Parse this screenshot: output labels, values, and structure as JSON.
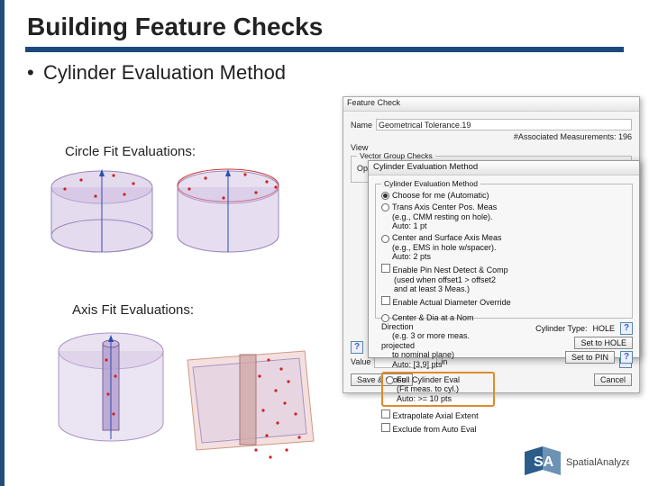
{
  "title": "Building Feature Checks",
  "bullet": "Cylinder Evaluation Method",
  "sections": {
    "circle": "Circle Fit Evaluations:",
    "axis": "Axis Fit Evaluations:"
  },
  "back_dialog": {
    "title": "Feature Check",
    "name_label": "Name",
    "name_value": "Geometrical Tolerance.19",
    "assoc": "#Associated Measurements: 196",
    "view_label": "View",
    "group_vector": "Vector Group Checks",
    "options_label": "Options",
    "value_label": "Value",
    "value_unit": "in",
    "save_close": "Save & Close",
    "cancel": "Cancel"
  },
  "front_dialog": {
    "title": "Cylinder Evaluation Method",
    "group": "Cylinder Evaluation Method",
    "opt1": "Choose for me (Automatic)",
    "opt2a": "Trans Axis Center Pos. Meas",
    "opt2b": "(e.g., CMM resting on hole).",
    "opt2c": "Auto: 1 pt",
    "opt3a": "Center and Surface Axis Meas",
    "opt3b": "(e.g., EMS in hole w/spacer).",
    "opt3c": "Auto: 2 pts",
    "opt4a": "Center & Dia at a Nom Direction",
    "opt4b": "(e.g. 3 or more meas. projected",
    "opt4c": "to nominal plane)",
    "opt4d": "Auto: [3,9] pts",
    "opt5a": "Full Cylinder Eval",
    "opt5b": "(Fit meas. to cyl.)",
    "opt5c": "Auto: >= 10 pts",
    "chk_extrap": "Extrapolate Axial Extent",
    "chk_excl": "Exclude from Auto Eval",
    "nest_a": "Enable Pin Nest Detect & Comp",
    "nest_b": "(used when offset1 > offset2",
    "nest_c": "and at least 3 Meas.)",
    "override": "Enable Actual Diameter Override",
    "ctype_label": "Cylinder Type:",
    "ctype_value": "HOLE",
    "set_hole": "Set to HOLE",
    "set_pin": "Set to PIN"
  },
  "logo": {
    "sa": "SA",
    "name": "SpatialAnalyzer"
  }
}
